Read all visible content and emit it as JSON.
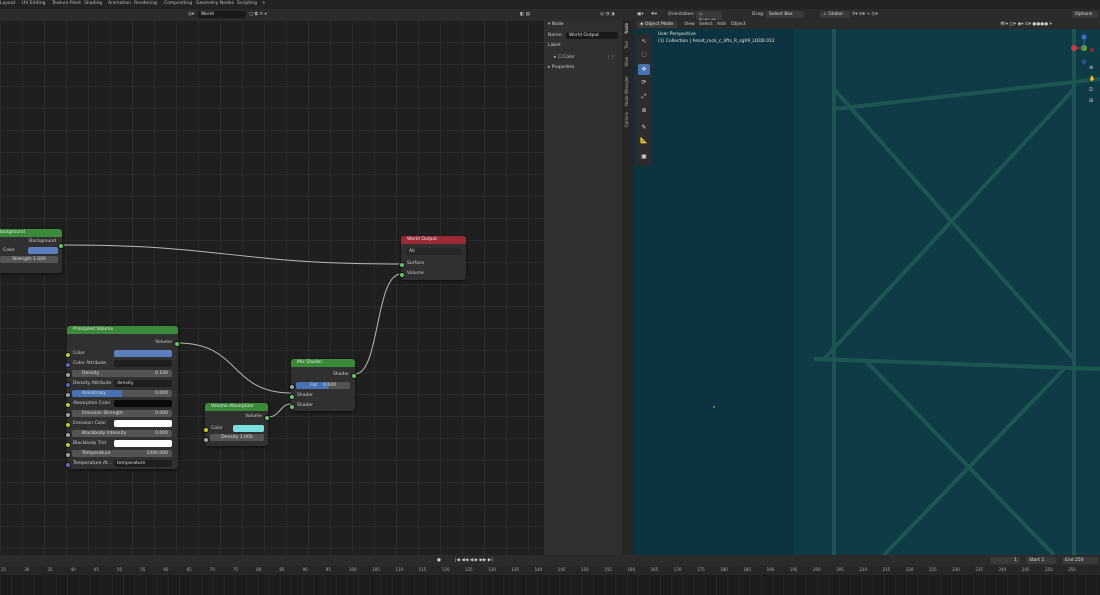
{
  "workspace_tabs": [
    "Layout",
    "UV Editing",
    "Texture Paint",
    "Shading",
    "Animation",
    "Rendering",
    "Compositing",
    "Geometry Nodes",
    "Scripting",
    "+"
  ],
  "node_header": {
    "world_name": "World"
  },
  "viewport_header": {
    "orientation_label": "Orientation:",
    "orientation_value": "Default",
    "drag_label": "Drag:",
    "drag_value": "Select Box",
    "transform_value": "Global",
    "options_label": "Options",
    "mode": "Object Mode",
    "menu": [
      "View",
      "Select",
      "Add",
      "Object"
    ]
  },
  "viewport_overlay": {
    "title": "User Perspective",
    "subtitle": "(1) Collection | Asset_rock_c_lifts_R_sgh9_LOD0.012"
  },
  "props_panel": {
    "section": "Node",
    "name_label": "Name:",
    "name_value": "World Output",
    "label_label": "Label:",
    "color_label": "Color",
    "properties_label": "Properties",
    "vtabs": [
      "Node",
      "Tool",
      "View",
      "Node Wrangler",
      "Options"
    ]
  },
  "nodes": {
    "background": {
      "title": "Background",
      "output": "Background",
      "color_label": "Color",
      "strength_label": "Strength",
      "strength_value": "1.000",
      "color": "#5b7fbf"
    },
    "world_output": {
      "title": "World Output",
      "target": "All",
      "surface": "Surface",
      "volume": "Volume"
    },
    "principled": {
      "title": "Principled Volume",
      "output": "Volume",
      "color": "Color",
      "color_attr": "Color Attribute",
      "density": "Density",
      "density_value": "0.100",
      "density_attr": "Density Attribute",
      "density_attr_value": "density",
      "anisotropy": "Anisotropy",
      "anisotropy_value": "0.000",
      "absorption": "Absorption Color",
      "emission_strength": "Emission Strength",
      "emission_strength_value": "0.000",
      "emission_color": "Emission Color",
      "blackbody_intensity": "Blackbody Intensity",
      "blackbody_intensity_value": "0.000",
      "blackbody_tint": "Blackbody Tint",
      "temperature": "Temperature",
      "temperature_value": "1000.000",
      "temperature_attr": "Temperature At...",
      "temperature_attr_value": "temperature",
      "color_swatch": "#5b7fbf"
    },
    "volume_absorption": {
      "title": "Volume Absorption",
      "output": "Volume",
      "color": "Color",
      "density": "Density",
      "density_value": "1.000",
      "swatch": "#7de0e0"
    },
    "mix_shader": {
      "title": "Mix Shader",
      "output": "Shader",
      "fac": "Fac",
      "fac_value": "0.600",
      "in1": "Shader",
      "in2": "Shader"
    }
  },
  "timeline": {
    "frame": "1",
    "start_label": "Start",
    "start_value": "1",
    "end_label": "End",
    "end_value": "250",
    "ticks": [
      "25",
      "30",
      "35",
      "40",
      "45",
      "50",
      "55",
      "60",
      "65",
      "70",
      "75",
      "80",
      "85",
      "90",
      "95",
      "100",
      "105",
      "110",
      "115",
      "120",
      "125",
      "130",
      "135",
      "140",
      "145",
      "150",
      "155",
      "160",
      "165",
      "170",
      "175",
      "180",
      "185",
      "190",
      "195",
      "200",
      "205",
      "210",
      "215",
      "220",
      "225",
      "230",
      "235",
      "240",
      "245",
      "250",
      "255"
    ]
  },
  "colors": {
    "node_header_green": "#3a8a3a",
    "node_header_red": "#9c2a35",
    "viewport_bg": "#0d3440",
    "active_tool": "#4772b3"
  }
}
